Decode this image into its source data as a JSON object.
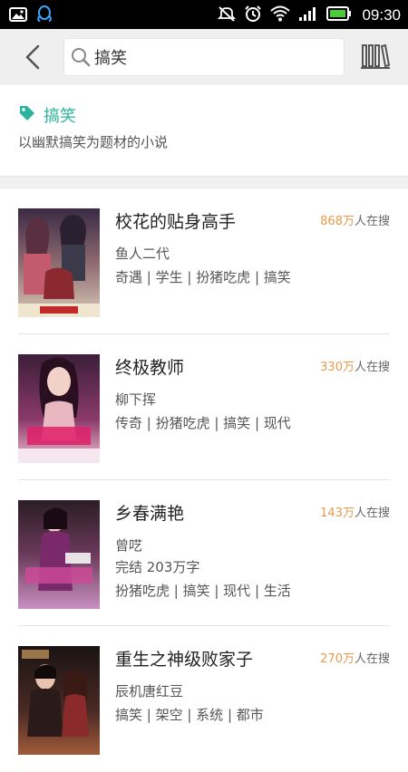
{
  "status_bar": {
    "time": "09:30"
  },
  "search": {
    "value": "搞笑"
  },
  "tag": {
    "name": "搞笑",
    "description": "以幽默搞笑为题材的小说"
  },
  "books": [
    {
      "title": "校花的贴身高手",
      "author": "鱼人二代",
      "searchers_num": "868万",
      "searchers_suffix": "人在搜",
      "status": "",
      "tags": "奇遇 | 学生 | 扮猪吃虎 | 搞笑"
    },
    {
      "title": "终极教师",
      "author": "柳下挥",
      "searchers_num": "330万",
      "searchers_suffix": "人在搜",
      "status": "",
      "tags": "传奇 | 扮猪吃虎 | 搞笑 | 现代"
    },
    {
      "title": "乡春满艳",
      "author": "曾呓",
      "searchers_num": "143万",
      "searchers_suffix": "人在搜",
      "status": "完结  203万字",
      "tags": "扮猪吃虎 | 搞笑 | 现代 | 生活"
    },
    {
      "title": "重生之神级败家子",
      "author": "辰机唐红豆",
      "searchers_num": "270万",
      "searchers_suffix": "人在搜",
      "status": "",
      "tags": "搞笑 | 架空 | 系统 | 都市"
    }
  ]
}
